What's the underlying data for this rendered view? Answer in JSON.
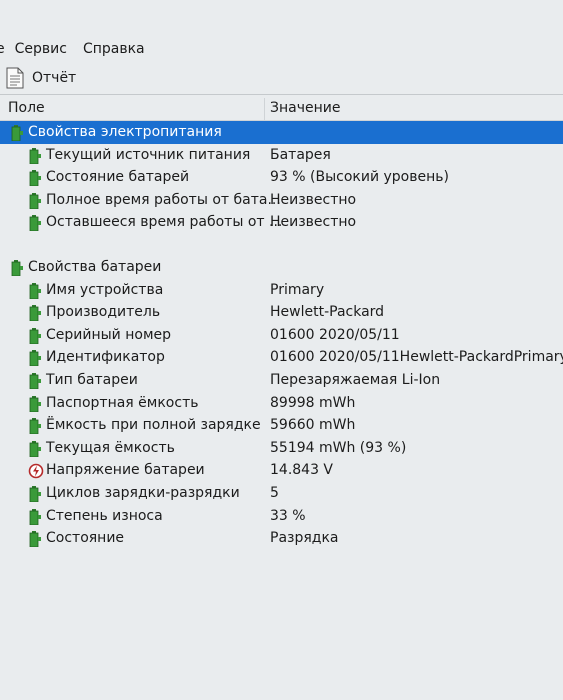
{
  "menu": {
    "items": [
      "е",
      "Сервис",
      "Справка"
    ]
  },
  "toolbar": {
    "report_label": "Отчёт"
  },
  "columns": {
    "field": "Поле",
    "value": "Значение"
  },
  "groups": [
    {
      "label": "Свойства электропитания",
      "selected": true,
      "rows": [
        {
          "name": "Текущий источник питания",
          "value": "Батарея",
          "icon": "battery-icon"
        },
        {
          "name": "Состояние батарей",
          "value": "93 % (Высокий уровень)",
          "icon": "battery-icon"
        },
        {
          "name": "Полное время работы от бата...",
          "value": "Неизвестно",
          "icon": "battery-icon"
        },
        {
          "name": "Оставшееся время работы от ...",
          "value": "Неизвестно",
          "icon": "battery-icon"
        }
      ]
    },
    {
      "label": "Свойства батареи",
      "selected": false,
      "rows": [
        {
          "name": "Имя устройства",
          "value": "Primary",
          "icon": "battery-icon"
        },
        {
          "name": "Производитель",
          "value": "Hewlett-Packard",
          "icon": "battery-icon"
        },
        {
          "name": "Серийный номер",
          "value": "01600 2020/05/11",
          "icon": "battery-icon"
        },
        {
          "name": "Идентификатор",
          "value": "01600 2020/05/11Hewlett-PackardPrimary",
          "icon": "battery-icon"
        },
        {
          "name": "Тип батареи",
          "value": "Перезаряжаемая Li-Ion",
          "icon": "battery-icon"
        },
        {
          "name": "Паспортная ёмкость",
          "value": "89998 mWh",
          "icon": "battery-icon"
        },
        {
          "name": "Ёмкость при полной зарядке",
          "value": "59660 mWh",
          "icon": "battery-icon"
        },
        {
          "name": "Текущая ёмкость",
          "value": "55194 mWh  (93 %)",
          "icon": "battery-icon"
        },
        {
          "name": "Напряжение батареи",
          "value": "14.843 V",
          "icon": "voltage-icon"
        },
        {
          "name": "Циклов зарядки-разрядки",
          "value": "5",
          "icon": "battery-icon"
        },
        {
          "name": "Степень износа",
          "value": "33 %",
          "icon": "battery-icon"
        },
        {
          "name": "Состояние",
          "value": "Разрядка",
          "icon": "battery-icon"
        }
      ]
    }
  ],
  "colors": {
    "selection": "#1a6fd0",
    "battery_green": "#3a9a3a",
    "background": "#e9ecee"
  }
}
